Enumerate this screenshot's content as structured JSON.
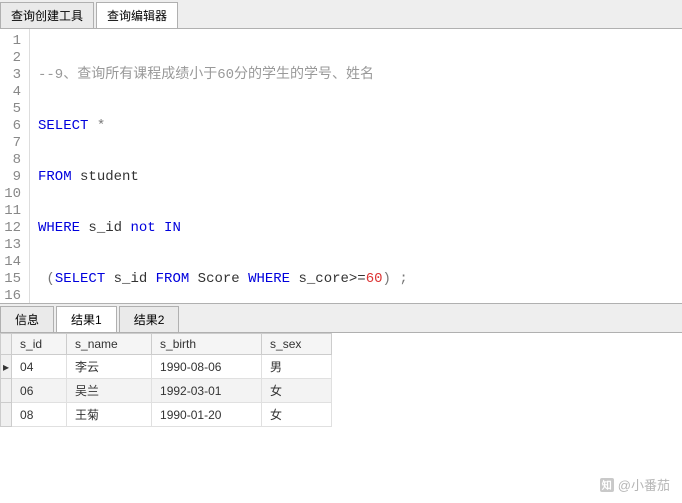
{
  "top_tabs": {
    "create": "查询创建工具",
    "editor": "查询编辑器"
  },
  "editor": {
    "line_numbers": [
      "1",
      "2",
      "3",
      "4",
      "5",
      "6",
      "7",
      "8",
      "9",
      "10",
      "11",
      "12",
      "13",
      "14",
      "15",
      "16"
    ],
    "l1_comment": "--9、查询所有课程成绩小于60分的学生的学号、姓名",
    "l2_select": "SELECT",
    "l2_star": " *",
    "l3_from": "FROM",
    "l3_tbl": " student",
    "l4_where": "WHERE",
    "l4_col": " s_id ",
    "l4_not": "not",
    "l4_in": " IN",
    "l5_open": " (",
    "l5_select": "SELECT",
    "l5_col": " s_id ",
    "l5_from": "FROM",
    "l5_tbl": " Score ",
    "l5_where": "WHERE",
    "l5_cond": " s_core>=",
    "l5_num": "60",
    "l5_close": ") ;"
  },
  "bottom_tabs": {
    "info": "信息",
    "res1": "结果1",
    "res2": "结果2"
  },
  "grid": {
    "headers": {
      "c1": "s_id",
      "c2": "s_name",
      "c3": "s_birth",
      "c4": "s_sex"
    },
    "pointer": "▸",
    "rows": [
      {
        "c1": "04",
        "c2": "李云",
        "c3": "1990-08-06",
        "c4": "男"
      },
      {
        "c1": "06",
        "c2": "吴兰",
        "c3": "1992-03-01",
        "c4": "女"
      },
      {
        "c1": "08",
        "c2": "王菊",
        "c3": "1990-01-20",
        "c4": "女"
      }
    ]
  },
  "watermark": {
    "logo": "知",
    "text": "@小番茄"
  }
}
